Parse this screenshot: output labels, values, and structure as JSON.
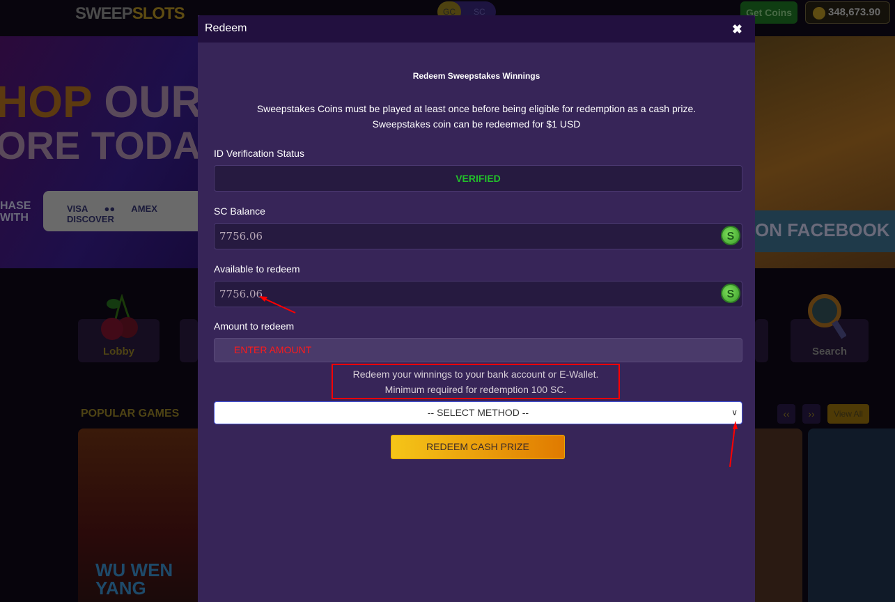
{
  "header": {
    "logo_part1": "SWEEP",
    "logo_part2": "SLOTS",
    "currency_toggle": {
      "gc": "GC",
      "sc": "SC"
    },
    "get_coins_label": "Get Coins",
    "balance": "348,673.90"
  },
  "banners": {
    "left_line1a": "HOP ",
    "left_line1b": "OUR",
    "left_line2": "ORE TODAY",
    "left_purchase": "HASE\nWITH",
    "payment_cards": "VISA ●● AMEX DISCOVER",
    "right_text": "ON FACEBOOK"
  },
  "categories": [
    {
      "label": "Lobby",
      "icon": "cherry-icon"
    },
    {
      "label": "Search",
      "icon": "magnifier-icon"
    }
  ],
  "popular": {
    "title": "POPULAR GAMES",
    "prev": "‹‹",
    "next": "››",
    "view_all": "View All",
    "game1_title": "WU WEN YANG"
  },
  "modal": {
    "title": "Redeem",
    "close": "✖",
    "subtitle": "Redeem Sweepstakes Winnings",
    "description_line1": "Sweepstakes Coins must be played at least once before being eligible for redemption as a cash prize.",
    "description_line2": "Sweepstakes coin can be redeemed for $1 USD",
    "id_status_label": "ID Verification Status",
    "id_status_value": "VERIFIED",
    "sc_balance_label": "SC Balance",
    "sc_balance_value": "7756.06",
    "available_label": "Available to redeem",
    "available_value": "7756.06",
    "amount_label": "Amount to redeem",
    "amount_placeholder": "ENTER AMOUNT",
    "info_line1": "Redeem your winnings to your bank account or E-Wallet.",
    "info_line2": "Minimum required for redemption 100 SC.",
    "method_select": "-- SELECT METHOD --",
    "redeem_button": "REDEEM CASH PRIZE",
    "coin_symbol": "S"
  },
  "colors": {
    "modal_bg": "#372558",
    "modal_header": "#22103f",
    "verified": "#22c02a",
    "annotation_red": "#ff0000",
    "button_start": "#f5c518",
    "button_end": "#e07a00"
  }
}
